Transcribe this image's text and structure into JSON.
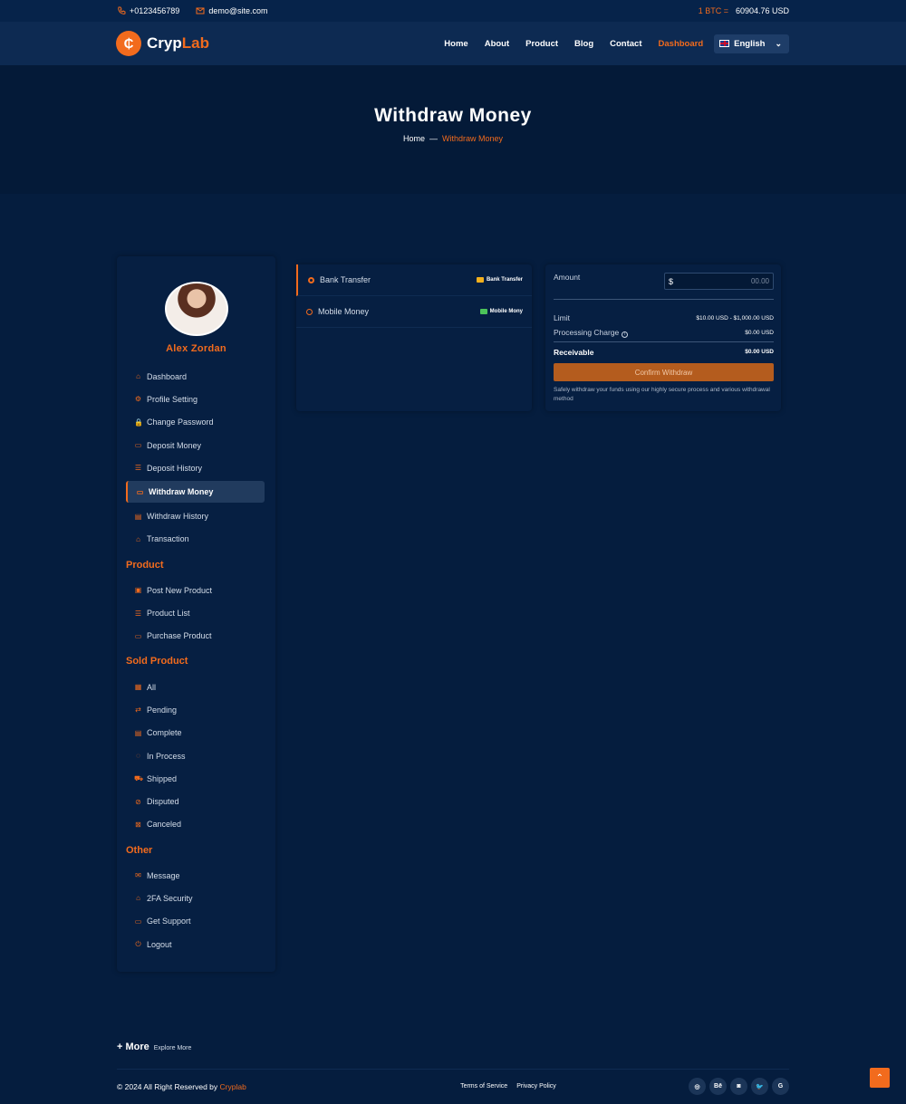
{
  "topbar": {
    "phone": "+0123456789",
    "email": "demo@site.com",
    "price_label": "1 BTC =",
    "price_value": "60904.76 USD"
  },
  "brand": {
    "name_main": "Cryp",
    "name_accent": "Lab",
    "logo_glyph": "₵"
  },
  "nav": {
    "items": [
      "Home",
      "About",
      "Product",
      "Blog",
      "Contact",
      "Dashboard"
    ],
    "active": "Dashboard",
    "language": "English"
  },
  "hero": {
    "title": "Withdraw Money",
    "breadcrumb_home": "Home",
    "breadcrumb_sep": "—",
    "breadcrumb_current": "Withdraw Money"
  },
  "profile": {
    "name": "Alex Zordan"
  },
  "sidebar": {
    "main": [
      {
        "label": "Dashboard",
        "icon": "⌂"
      },
      {
        "label": "Profile Setting",
        "icon": "⚙"
      },
      {
        "label": "Change Password",
        "icon": "🔒"
      },
      {
        "label": "Deposit Money",
        "icon": "▭"
      },
      {
        "label": "Deposit History",
        "icon": "☰"
      },
      {
        "label": "Withdraw Money",
        "icon": "▭"
      },
      {
        "label": "Withdraw History",
        "icon": "▤"
      },
      {
        "label": "Transaction",
        "icon": "⌂"
      }
    ],
    "product_heading": "Product",
    "product": [
      {
        "label": "Post New Product",
        "icon": "▣"
      },
      {
        "label": "Product List",
        "icon": "☰"
      },
      {
        "label": "Purchase Product",
        "icon": "▭"
      }
    ],
    "sold_heading": "Sold Product",
    "sold": [
      {
        "label": "All",
        "icon": "▦"
      },
      {
        "label": "Pending",
        "icon": "⇄"
      },
      {
        "label": "Complete",
        "icon": "▤"
      },
      {
        "label": "In Process",
        "icon": "◌"
      },
      {
        "label": "Shipped",
        "icon": "⛟"
      },
      {
        "label": "Disputed",
        "icon": "⊘"
      },
      {
        "label": "Canceled",
        "icon": "⊠"
      }
    ],
    "other_heading": "Other",
    "other": [
      {
        "label": "Message",
        "icon": "✉"
      },
      {
        "label": "2FA Security",
        "icon": "⌂"
      },
      {
        "label": "Get Support",
        "icon": "▭"
      },
      {
        "label": "Logout",
        "icon": "⏻"
      }
    ]
  },
  "methods": [
    {
      "label": "Bank Transfer",
      "tag": "Bank Transfer"
    },
    {
      "label": "Mobile Money",
      "tag": "Mobile Mony"
    }
  ],
  "summary": {
    "amount_label": "Amount",
    "currency": "$",
    "amount_placeholder": "00.00",
    "limit_label": "Limit",
    "limit_value": "$10.00 USD - $1,000.00 USD",
    "charge_label": "Processing Charge",
    "charge_value": "$0.00 USD",
    "receivable_label": "Receivable",
    "receivable_value": "$0.00 USD",
    "confirm_label": "Confirm Withdraw",
    "note": "Safely withdraw your funds using our highly secure process and various withdrawal method"
  },
  "footer": {
    "more_label": "+ More",
    "more_sub": "Explore More",
    "copyright": "© 2024 All Right Reserved by",
    "copyright_brand": "Cryplab",
    "terms": "Terms of Service",
    "privacy": "Privacy Policy",
    "socials": [
      "◎",
      "Bē",
      "◙",
      "🐦",
      "G"
    ]
  },
  "colors": {
    "accent": "#f26b1d",
    "background": "#051d3e",
    "panel": "#061f42"
  }
}
